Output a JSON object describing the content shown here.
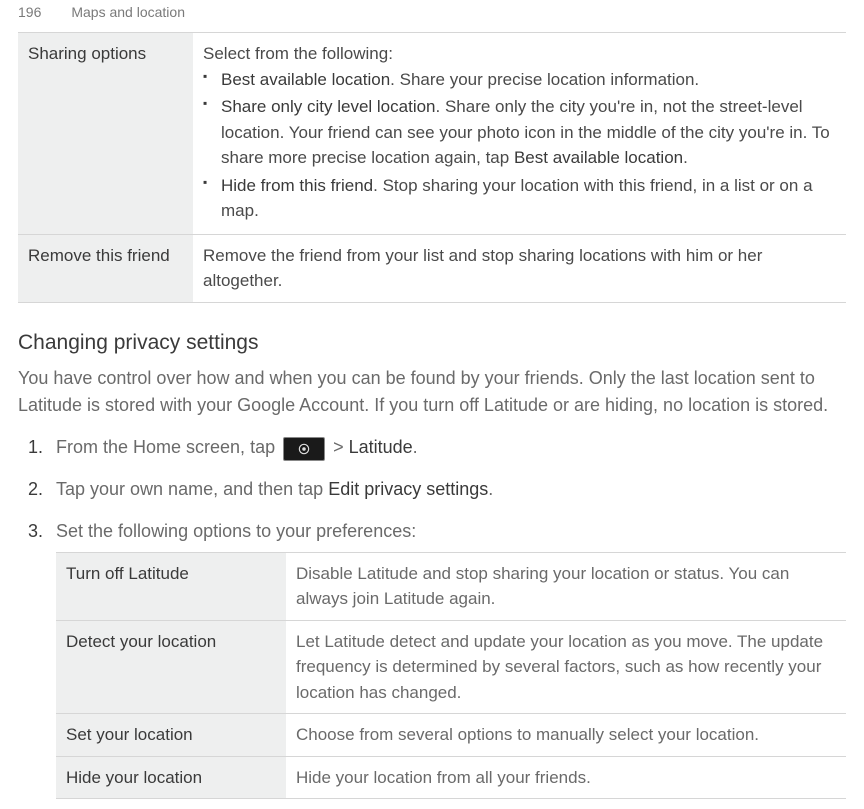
{
  "header": {
    "pageNumber": "196",
    "section": "Maps and location"
  },
  "table1": {
    "row1": {
      "label": "Sharing options",
      "intro": "Select from the following:",
      "b1_strong": "Best available location",
      "b1_rest": ". Share your precise location information.",
      "b2_strong": "Share only city level location",
      "b2_rest_a": ". Share only the city you're in, not the street-level location. Your friend can see your photo icon in the middle of the city you're in. To share more precise location again, tap ",
      "b2_rest_strong": "Best available location",
      "b2_rest_b": ".",
      "b3_strong": "Hide from this friend",
      "b3_rest": ". Stop sharing your location with this friend, in a list or on a map."
    },
    "row2": {
      "label": "Remove this friend",
      "desc": "Remove the friend from your list and stop sharing locations with him or her altogether."
    }
  },
  "section": {
    "title": "Changing privacy settings",
    "intro": "You have control over how and when you can be found by your friends. Only the last location sent to Latitude is stored with your Google Account. If you turn off Latitude or are hiding, no location is stored.",
    "step1_a": "From the Home screen, tap ",
    "step1_b": " > ",
    "step1_strong": "Latitude",
    "step1_c": ".",
    "step2_a": "Tap your own name, and then tap ",
    "step2_strong": "Edit privacy settings",
    "step2_b": ".",
    "step3": "Set the following options to your preferences:"
  },
  "table2": {
    "r1": {
      "label": "Turn off Latitude",
      "desc": "Disable Latitude and stop sharing your location or status. You can always join Latitude again."
    },
    "r2": {
      "label": "Detect your location",
      "desc": "Let Latitude detect and update your location as you move. The update frequency is determined by several factors, such as how recently your location has changed."
    },
    "r3": {
      "label": "Set your location",
      "desc": "Choose from several options to manually select your location."
    },
    "r4": {
      "label": "Hide your location",
      "desc": "Hide your location from all your friends."
    }
  }
}
